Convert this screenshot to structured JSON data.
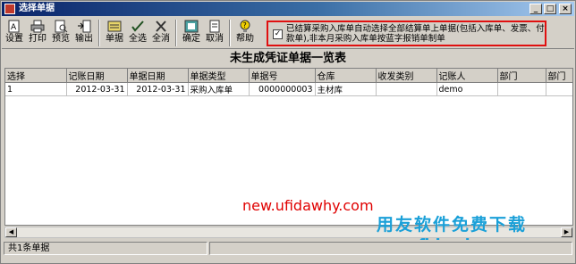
{
  "window": {
    "title": "选择单据"
  },
  "toolbar": {
    "buttons": [
      {
        "label": "设置"
      },
      {
        "label": "打印"
      },
      {
        "label": "预览"
      },
      {
        "label": "输出"
      },
      {
        "label": "单据"
      },
      {
        "label": "全选"
      },
      {
        "label": "全消"
      },
      {
        "label": "确定"
      },
      {
        "label": "取消"
      },
      {
        "label": "帮助"
      }
    ],
    "notice": {
      "checked": true,
      "text": "已结算采购入库单自动选择全部结算单上单据(包括入库单、发票、付款单),非本月采购入库单按蓝字报销单制单"
    }
  },
  "main": {
    "heading": "未生成凭证单据一览表"
  },
  "table": {
    "columns": [
      "选择",
      "记账日期",
      "单据日期",
      "单据类型",
      "单据号",
      "仓库",
      "收发类别",
      "记账人",
      "部门",
      "部门"
    ],
    "rows": [
      [
        "1",
        "2012-03-31",
        "2012-03-31",
        "采购入库单",
        "0000000003",
        "主材库",
        "",
        "demo",
        "",
        ""
      ]
    ]
  },
  "watermark": {
    "url1": "new.ufidawhy.com",
    "brand": "用友软件免费下载",
    "url2": "new.ufidawhy.com"
  },
  "status": {
    "count": "共1条单据"
  }
}
